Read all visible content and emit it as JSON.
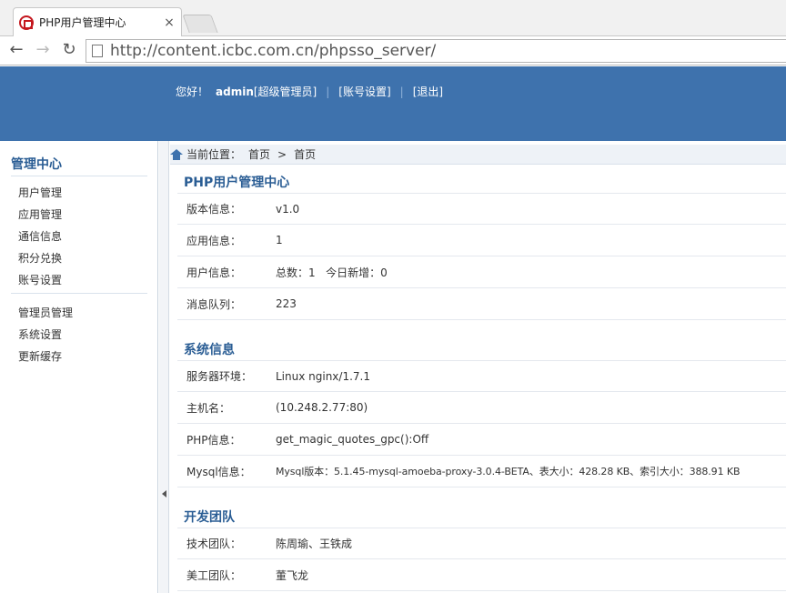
{
  "browser": {
    "tab_title": "PHP用户管理中心",
    "tab_close": "×",
    "url": "http://content.icbc.com.cn/phpsso_server/"
  },
  "header": {
    "greeting": "您好！",
    "username": "admin",
    "role": "[超级管理员]",
    "sep": "|",
    "account_settings": "[账号设置]",
    "logout": "[退出]"
  },
  "sidebar": {
    "title": "管理中心",
    "group1": [
      "用户管理",
      "应用管理",
      "通信信息",
      "积分兑换",
      "账号设置"
    ],
    "group2": [
      "管理员管理",
      "系统设置",
      "更新缓存"
    ]
  },
  "breadcrumb": {
    "label": "当前位置：",
    "home": "首页",
    "arrow": ">",
    "current": "首页"
  },
  "sections": {
    "app": {
      "title": "PHP用户管理中心",
      "rows": [
        {
          "label": "版本信息：",
          "value": "v1.0"
        },
        {
          "label": "应用信息：",
          "value": "1"
        },
        {
          "label": "用户信息：",
          "value": "总数：1   今日新增：0"
        },
        {
          "label": "消息队列：",
          "value": "223"
        }
      ]
    },
    "system": {
      "title": "系统信息",
      "rows": [
        {
          "label": "服务器环境：",
          "value": "Linux nginx/1.7.1"
        },
        {
          "label": "主机名：",
          "value": "(10.248.2.77:80)"
        },
        {
          "label": "PHP信息：",
          "value": "get_magic_quotes_gpc():Off"
        },
        {
          "label": "Mysql信息：",
          "value": "Mysql版本：5.1.45-mysql-amoeba-proxy-3.0.4-BETA、表大小：428.28 KB、索引大小：388.91 KB"
        }
      ]
    },
    "team": {
      "title": "开发团队",
      "rows": [
        {
          "label": "技术团队：",
          "value": "陈周瑜、王铁成"
        },
        {
          "label": "美工团队：",
          "value": "董飞龙"
        }
      ]
    }
  }
}
